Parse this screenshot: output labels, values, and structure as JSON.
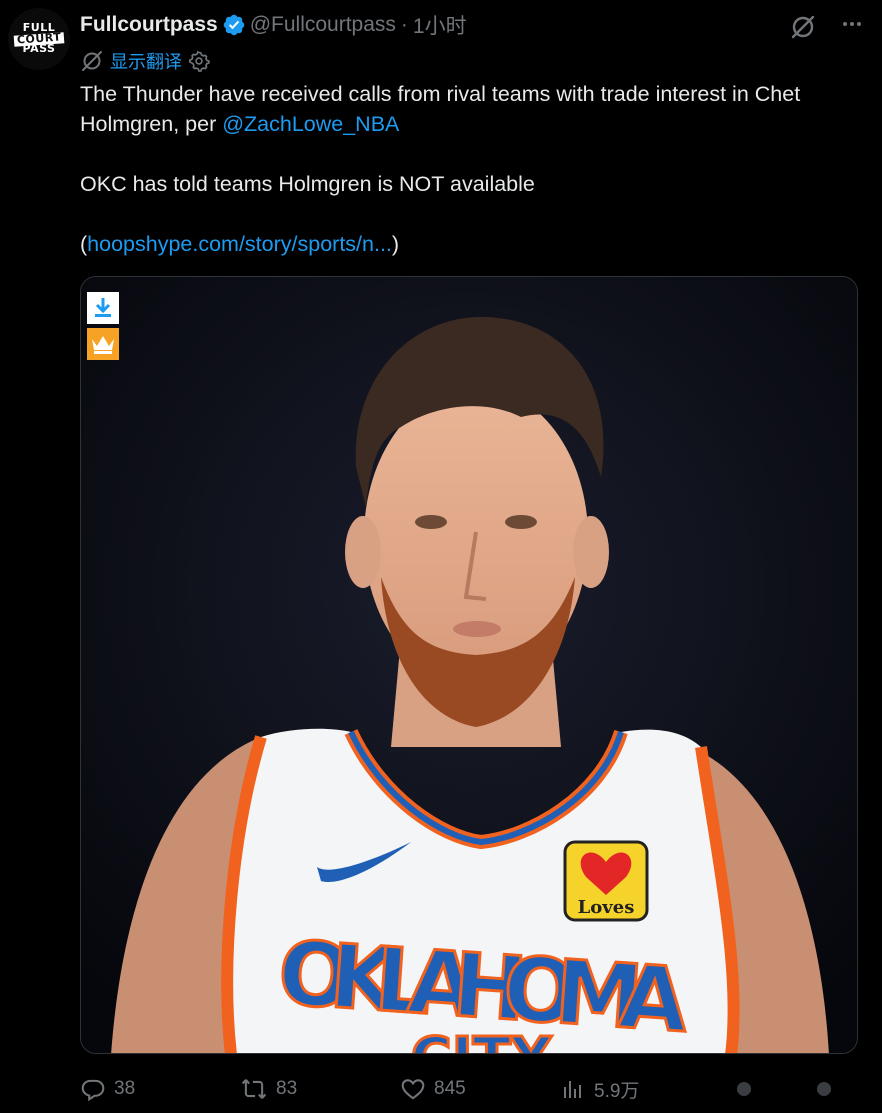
{
  "author": {
    "name": "Fullcourtpass",
    "handle": "@Fullcourtpass",
    "separator": "·",
    "time": "1小时",
    "avatar_text": [
      "FULL",
      "COURT",
      "PASS"
    ]
  },
  "translate": {
    "label": "显示翻译"
  },
  "tweet": {
    "line1_text": "The Thunder have received calls from rival teams with trade interest in Chet Holmgren, per ",
    "mention": "@ZachLowe_NBA",
    "line2_text": "OKC has told teams Holmgren is NOT available",
    "link_open": "(",
    "link": "hoopshype.com/story/sports/n...",
    "link_close": ")"
  },
  "media": {
    "jersey_text": "OKLAHOMA",
    "jersey_text2": "CITY",
    "sponsor": "Loves"
  },
  "actions": {
    "replies": "38",
    "reposts": "83",
    "likes": "845",
    "views": "5.9万"
  },
  "colors": {
    "accent": "#1d9bf0",
    "muted": "#71767b",
    "text": "#e7e9ea",
    "background": "#000000"
  },
  "icons": [
    "verified-badge-icon",
    "grok-icon",
    "more-icon",
    "translate-icon",
    "settings-icon",
    "download-icon",
    "crown-icon",
    "reply-icon",
    "repost-icon",
    "like-icon",
    "views-icon",
    "bookmark-icon",
    "share-icon"
  ]
}
